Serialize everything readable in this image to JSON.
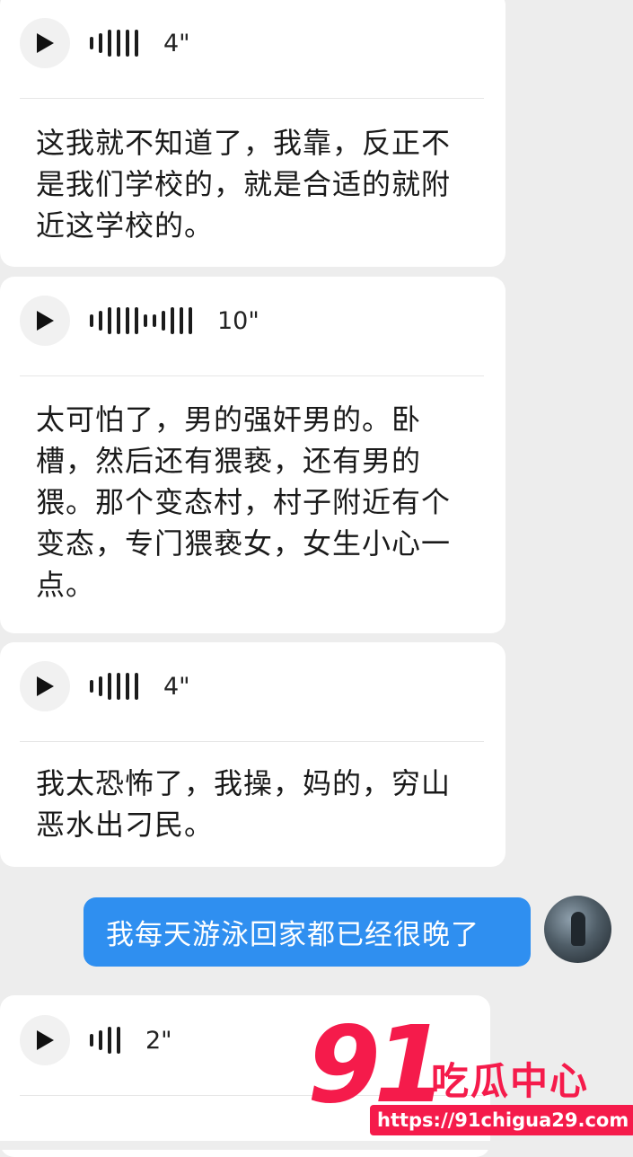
{
  "messages": [
    {
      "duration": "4\"",
      "text": "这我就不知道了，我靠，反正不是我们学校的，就是合适的就附近这学校的。"
    },
    {
      "duration": "10\"",
      "text": "太可怕了，男的强奸男的。卧槽，然后还有猥亵，还有男的猥。那个变态村，村子附近有个变态，专门猥亵女，女生小心一点。"
    },
    {
      "duration": "4\"",
      "text": "我太恐怖了，我操，妈的，穷山恶水出刁民。"
    },
    {
      "duration": "2\""
    }
  ],
  "outgoing": {
    "text": "我每天游泳回家都已经很晚了"
  },
  "watermark": {
    "number": "91",
    "name": "吃瓜中心",
    "url": "https://91chigua29.com"
  },
  "colors": {
    "background": "#ededed",
    "bubble": "#ffffff",
    "outgoing_bubble": "#2f8ff0",
    "watermark": "#f51b4b"
  },
  "icons": {
    "play": "play-icon",
    "waveform": "waveform-icon"
  }
}
